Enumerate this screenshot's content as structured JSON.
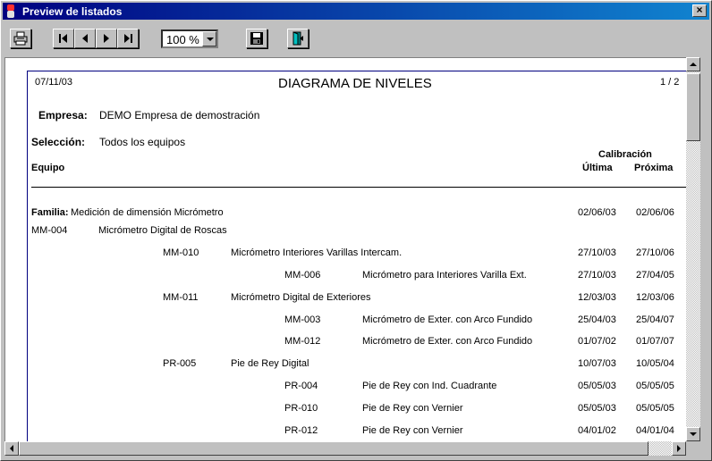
{
  "window": {
    "title": "Preview de listados",
    "close_label": "×"
  },
  "toolbar": {
    "zoom_value": "100 %"
  },
  "report": {
    "date": "07/11/03",
    "title": "DIAGRAMA DE NIVELES",
    "page": "1 / 2",
    "empresa_label": "Empresa:",
    "empresa_value": "DEMO Empresa de demostración",
    "seleccion_label": "Selección:",
    "seleccion_value": "Todos los equipos",
    "col_calibracion": "Calibración",
    "col_equipo": "Equipo",
    "col_ultima": "Última",
    "col_proxima": "Próxima",
    "familia_label": "Familia:",
    "familia_value": "Medición de dimensión Micrómetro",
    "familia_ultima": "02/06/03",
    "familia_proxima": "02/06/06",
    "rows": [
      {
        "code": "MM-004",
        "desc": "Micrómetro Digital de Roscas",
        "ultima": "",
        "proxima": ""
      },
      {
        "code": "MM-010",
        "desc": "Micrómetro Interiores Varillas Intercam.",
        "ultima": "27/10/03",
        "proxima": "27/10/06"
      },
      {
        "code": "MM-006",
        "desc": "Micrómetro para Interiores Varilla Ext.",
        "ultima": "27/10/03",
        "proxima": "27/04/05"
      },
      {
        "code": "MM-011",
        "desc": "Micrómetro Digital de Exteriores",
        "ultima": "12/03/03",
        "proxima": "12/03/06"
      },
      {
        "code": "MM-003",
        "desc": "Micrómetro de Exter. con Arco Fundido",
        "ultima": "25/04/03",
        "proxima": "25/04/07"
      },
      {
        "code": "MM-012",
        "desc": "Micrómetro de Exter. con Arco Fundido",
        "ultima": "01/07/02",
        "proxima": "01/07/07"
      },
      {
        "code": "PR-005",
        "desc": "Pie de Rey Digital",
        "ultima": "10/07/03",
        "proxima": "10/05/04"
      },
      {
        "code": "PR-004",
        "desc": "Pie de Rey con Ind. Cuadrante",
        "ultima": "05/05/03",
        "proxima": "05/05/05"
      },
      {
        "code": "PR-010",
        "desc": "Pie de Rey con Vernier",
        "ultima": "05/05/03",
        "proxima": "05/05/05"
      },
      {
        "code": "PR-012",
        "desc": "Pie de Rey con Vernier",
        "ultima": "04/01/02",
        "proxima": "04/01/04"
      }
    ]
  }
}
